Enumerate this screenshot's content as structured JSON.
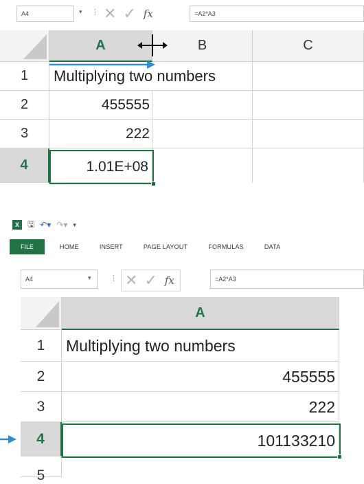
{
  "top": {
    "name_box": "A4",
    "formula": "=A2*A3",
    "columns": [
      "A",
      "B",
      "C"
    ],
    "rows": [
      "1",
      "2",
      "3",
      "4"
    ],
    "cells": {
      "a1": "Multiplying two numbers",
      "a2": "455555",
      "a3": "222",
      "a4": "1.01E+08"
    }
  },
  "bottom": {
    "ribbon_tabs": [
      "FILE",
      "HOME",
      "INSERT",
      "PAGE LAYOUT",
      "FORMULAS",
      "DATA"
    ],
    "name_box": "A4",
    "formula": "=A2*A3",
    "columns": [
      "A"
    ],
    "rows": [
      "1",
      "2",
      "3",
      "4",
      "5"
    ],
    "cells": {
      "a1": "Multiplying two numbers",
      "a2": "455555",
      "a3": "222",
      "a4": "101133210"
    }
  },
  "colors": {
    "accent": "#217346",
    "arrow": "#2e8fd0"
  }
}
